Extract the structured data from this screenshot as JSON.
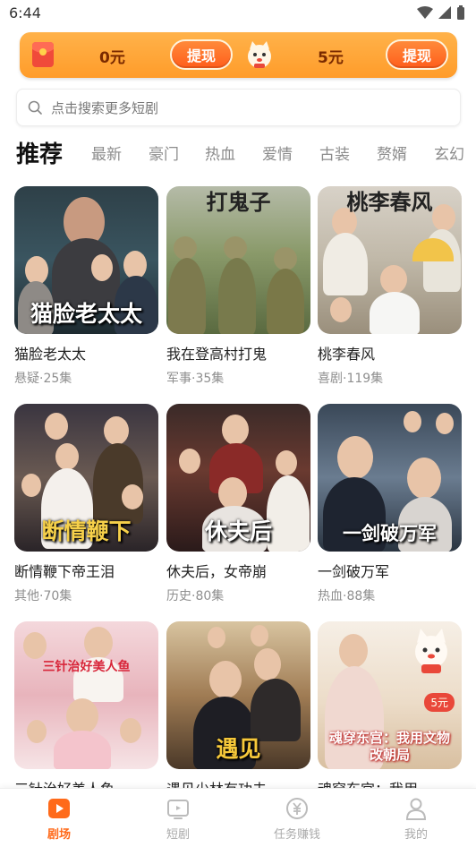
{
  "status": {
    "time": "6:44"
  },
  "rewards": {
    "left_amount": "0元",
    "left_button": "提现",
    "right_amount": "5元",
    "right_button": "提现"
  },
  "search": {
    "placeholder": "点击搜索更多短剧"
  },
  "tabs": [
    "推荐",
    "最新",
    "豪门",
    "热血",
    "爱情",
    "古装",
    "赘婿",
    "玄幻"
  ],
  "dramas": [
    {
      "title": "猫脸老太太",
      "meta": "悬疑·25集",
      "poster_text": "猫脸老太太"
    },
    {
      "title": "我在登高村打鬼",
      "meta": "军事·35集",
      "poster_text": "打鬼子"
    },
    {
      "title": "桃李春风",
      "meta": "喜剧·119集",
      "poster_text": "桃李春风"
    },
    {
      "title": "断情鞭下帝王泪",
      "meta": "其他·70集",
      "poster_text": "断情鞭下"
    },
    {
      "title": "休夫后，女帝崩",
      "meta": "历史·80集",
      "poster_text": "休夫后"
    },
    {
      "title": "一剑破万军",
      "meta": "热血·88集",
      "poster_text": "一剑破万军"
    },
    {
      "title": "三针治好美人鱼",
      "meta": "",
      "poster_text": "三针治好美人鱼"
    },
    {
      "title": "遇见少林有功夫",
      "meta": "",
      "poster_text": "遇见"
    },
    {
      "title": "魂穿东宫：我用",
      "meta": "",
      "poster_text": "魂穿东宫：我用文物改朝局",
      "badge": "5元"
    }
  ],
  "nav": [
    {
      "label": "剧场",
      "icon": "theater-icon",
      "active": true
    },
    {
      "label": "短剧",
      "icon": "tv-icon",
      "active": false
    },
    {
      "label": "任务赚钱",
      "icon": "yuan-coin-icon",
      "active": false
    },
    {
      "label": "我的",
      "icon": "person-icon",
      "active": false
    }
  ],
  "colors": {
    "accent": "#ff6a1a",
    "reward_bg": "#ffa53a"
  }
}
